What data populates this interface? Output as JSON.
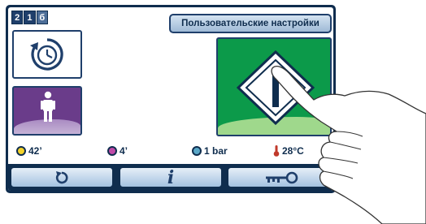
{
  "header": {
    "selector": [
      "2",
      "1",
      "б"
    ],
    "title": "Пользовательские настройки"
  },
  "tiles": {
    "timer_icon": "clock-cycle-icon",
    "user_icon": "person-icon",
    "main_icon": "door-opening-icon"
  },
  "status": {
    "timer_value": "42’",
    "cycle_value": "4’",
    "pressure_value": "1 bar",
    "temperature_value": "28°C"
  },
  "buttons": {
    "back_icon": "back-arrow-icon",
    "info_label": "i",
    "key_icon": "key-icon"
  },
  "colors": {
    "frame": "#0f2d4e",
    "main_tile": "#0c9a4a",
    "user_tile": "#6a3c8a",
    "button": "#a4c2e0"
  }
}
